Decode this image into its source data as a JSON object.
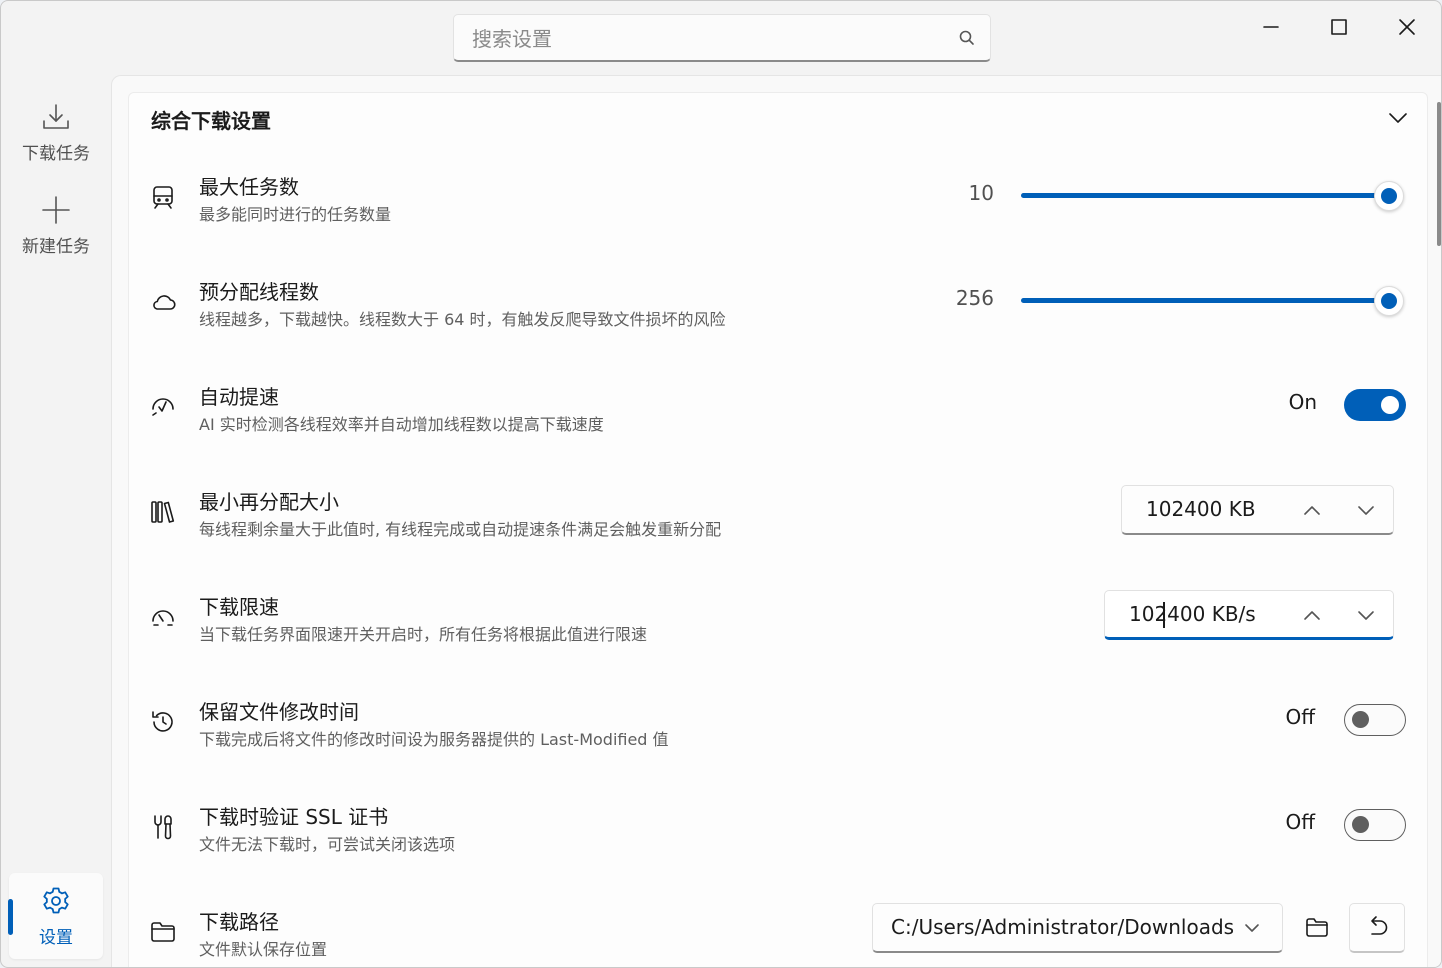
{
  "search": {
    "placeholder": "搜索设置",
    "icon": "search-icon"
  },
  "window_controls": [
    "minimize",
    "maximize",
    "close"
  ],
  "sidebar": {
    "items": [
      {
        "label": "下载任务",
        "icon": "download-icon"
      },
      {
        "label": "新建任务",
        "icon": "plus-icon"
      }
    ],
    "settings": {
      "label": "设置",
      "icon": "gear-icon",
      "active": true
    }
  },
  "section": {
    "title": "综合下载设置",
    "expanded": true
  },
  "settings": {
    "max_tasks": {
      "title": "最大任务数",
      "desc": "最多能同时进行的任务数量",
      "value": "10",
      "fill": 1.0
    },
    "prealloc_threads": {
      "title": "预分配线程数",
      "desc": "线程越多，下载越快。线程数大于 64 时，有触发反爬导致文件损坏的风险",
      "value": "256",
      "fill": 1.0
    },
    "auto_speedup": {
      "title": "自动提速",
      "desc": "AI 实时检测各线程效率并自动增加线程数以提高下载速度",
      "state": "On"
    },
    "min_realloc": {
      "title": "最小再分配大小",
      "desc": "每线程剩余量大于此值时, 有线程完成或自动提速条件满足会触发重新分配",
      "value": "102400 KB"
    },
    "speed_limit": {
      "title": "下载限速",
      "desc": "当下载任务界面限速开关开启时，所有任务将根据此值进行限速",
      "value": "102400 KB/s"
    },
    "keep_mtime": {
      "title": "保留文件修改时间",
      "desc": "下载完成后将文件的修改时间设为服务器提供的 Last-Modified 值",
      "state": "Off"
    },
    "verify_ssl": {
      "title": "下载时验证 SSL 证书",
      "desc": "文件无法下载时，可尝试关闭该选项",
      "state": "Off"
    },
    "download_path": {
      "title": "下载路径",
      "desc": "文件默认保存位置",
      "value": "C:/Users/Administrator/Downloads"
    }
  },
  "colors": {
    "accent": "#005fb8",
    "background": "#f3f3f3",
    "card": "#fdfdfd"
  }
}
